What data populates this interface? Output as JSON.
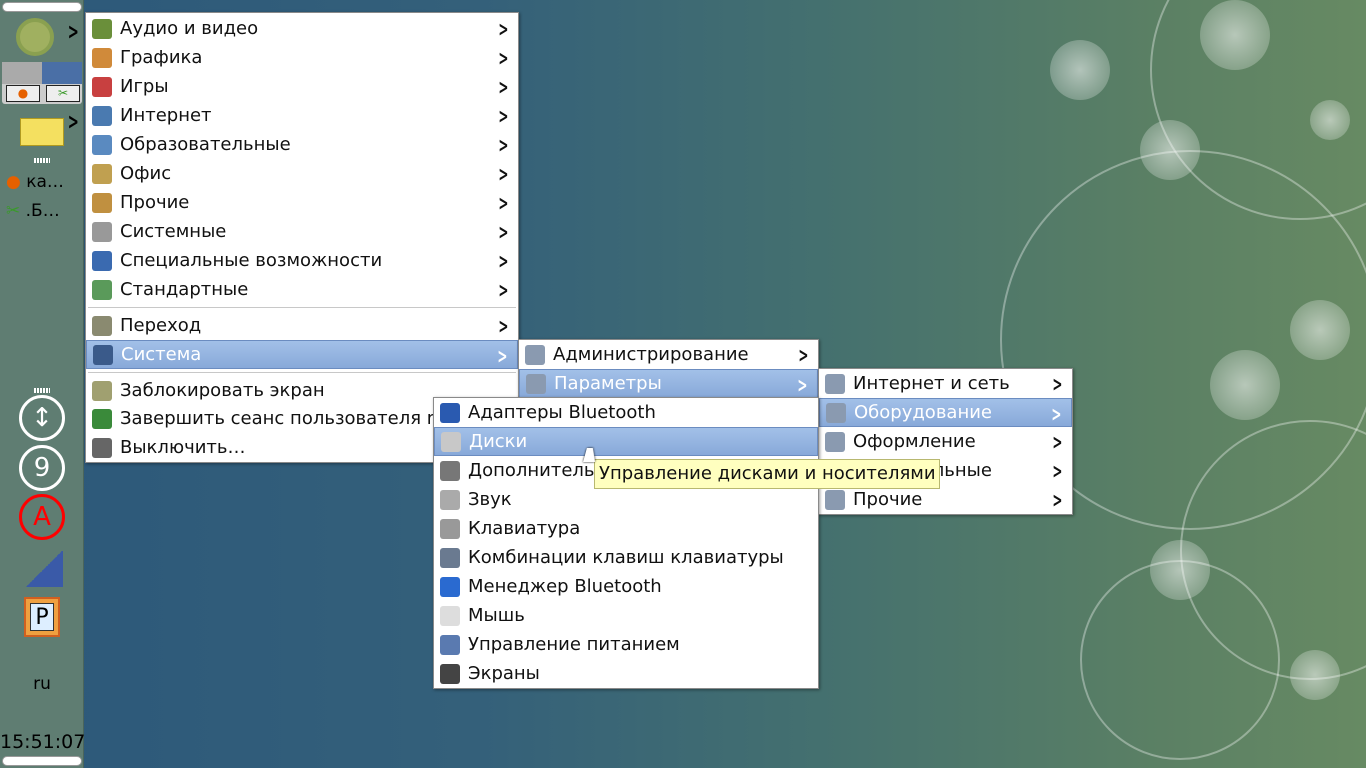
{
  "panel": {
    "task1": "ка…",
    "task2": ".Б…",
    "indicator_9": "9",
    "indicator_a": "A",
    "layout": "ru",
    "clock": "15:51:07"
  },
  "main_menu": [
    {
      "label": "Аудио и видео",
      "icon": "film-icon",
      "color": "#6a8f3a"
    },
    {
      "label": "Графика",
      "icon": "palette-icon",
      "color": "#d08a3a"
    },
    {
      "label": "Игры",
      "icon": "games-icon",
      "color": "#c84040"
    },
    {
      "label": "Интернет",
      "icon": "globe-icon",
      "color": "#4a7ab0"
    },
    {
      "label": "Образовательные",
      "icon": "education-icon",
      "color": "#5a8ac0"
    },
    {
      "label": "Офис",
      "icon": "office-icon",
      "color": "#c0a050"
    },
    {
      "label": "Прочие",
      "icon": "box-icon",
      "color": "#c09040"
    },
    {
      "label": "Системные",
      "icon": "gear-icon",
      "color": "#999999"
    },
    {
      "label": "Специальные возможности",
      "icon": "accessibility-icon",
      "color": "#3a6ab0"
    },
    {
      "label": "Стандартные",
      "icon": "tools-icon",
      "color": "#5a9a5a"
    },
    {
      "label": "Переход",
      "icon": "folder-icon",
      "color": "#8a8a70"
    },
    {
      "label": "Система",
      "icon": "computer-icon",
      "color": "#3a5a8a"
    },
    {
      "label": "Заблокировать экран",
      "icon": "lock-screen-icon",
      "color": "#a0a070"
    },
    {
      "label": "Завершить сеанс пользователя m",
      "icon": "logout-icon",
      "color": "#3a8a3a"
    },
    {
      "label": "Выключить…",
      "icon": "power-icon",
      "color": "#666666"
    }
  ],
  "system_menu": [
    {
      "label": "Администрирование",
      "icon": "tools-icon"
    },
    {
      "label": "Параметры",
      "icon": "settings-icon"
    }
  ],
  "params_menu": [
    {
      "label": "Интернет и сеть",
      "icon": "network-icon"
    },
    {
      "label": "Оборудование",
      "icon": "hardware-icon"
    },
    {
      "label": "Оформление",
      "icon": "appearance-icon"
    },
    {
      "label": "Персональные",
      "icon": "personal-icon"
    },
    {
      "label": "Прочие",
      "icon": "box-icon"
    }
  ],
  "hardware_menu": [
    {
      "label": "Адаптеры Bluetooth",
      "icon": "bluetooth-adapter-icon",
      "color": "#2a5ab0"
    },
    {
      "label": "Диски",
      "icon": "disk-icon",
      "color": "#c8c8c8"
    },
    {
      "label": "Дополнительные драйверы",
      "icon": "drivers-icon",
      "color": "#777777"
    },
    {
      "label": "Звук",
      "icon": "sound-icon",
      "color": "#aaaaaa"
    },
    {
      "label": "Клавиатура",
      "icon": "keyboard-icon",
      "color": "#999999"
    },
    {
      "label": "Комбинации клавиш клавиатуры",
      "icon": "keyboard-shortcuts-icon",
      "color": "#6a7a90"
    },
    {
      "label": "Менеджер Bluetooth",
      "icon": "bluetooth-icon",
      "color": "#2a6ad0"
    },
    {
      "label": "Мышь",
      "icon": "mouse-icon",
      "color": "#dddddd"
    },
    {
      "label": "Управление питанием",
      "icon": "power-management-icon",
      "color": "#5a7ab0"
    },
    {
      "label": "Экраны",
      "icon": "display-icon",
      "color": "#444444"
    }
  ],
  "tooltip": "Управление дисками и носителями"
}
